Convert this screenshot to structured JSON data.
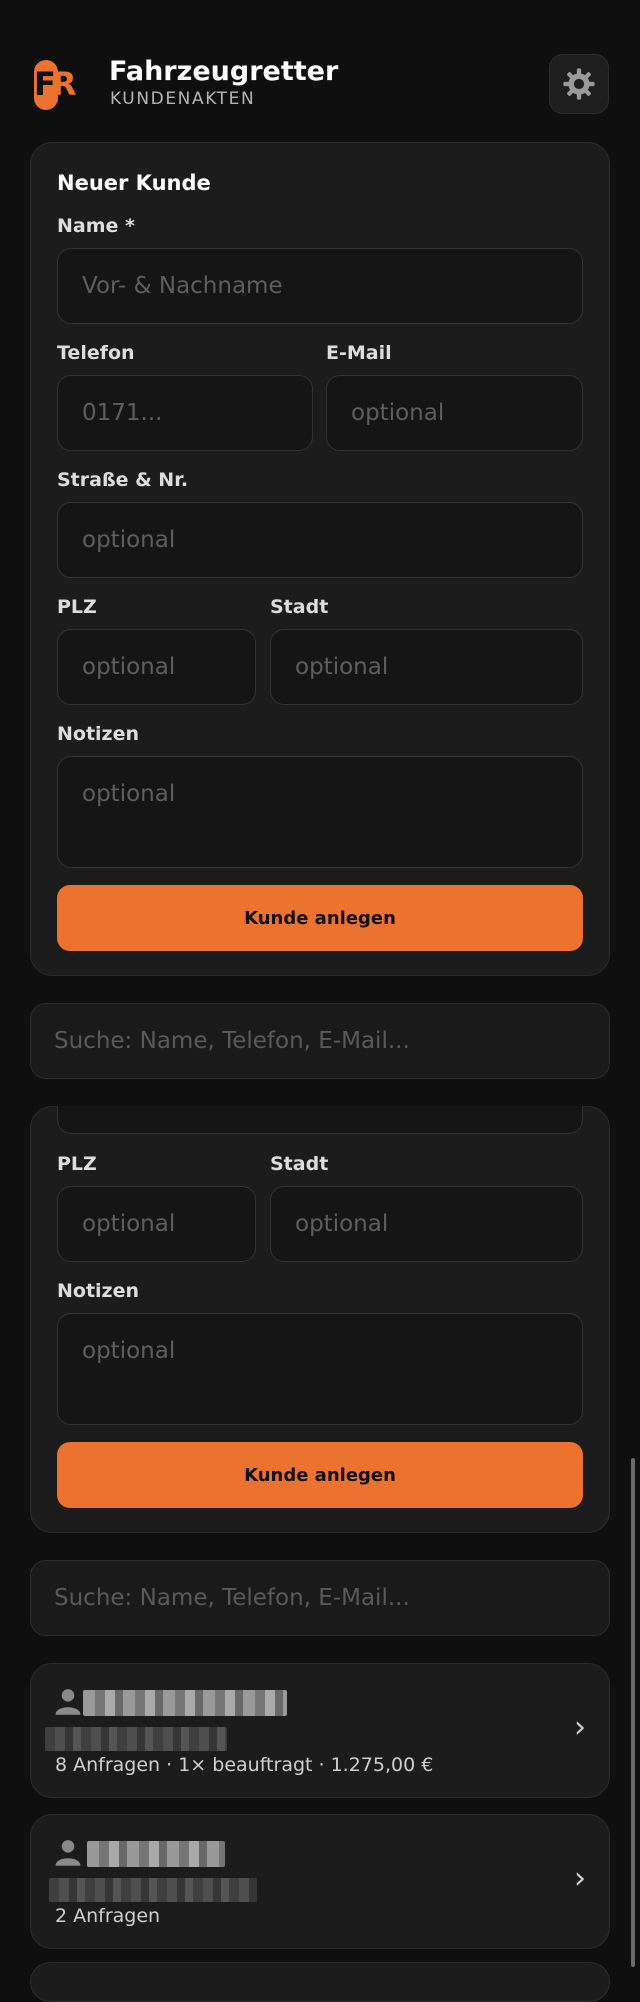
{
  "app": {
    "logo_text": "FR",
    "title": "Fahrzeugretter",
    "subtitle": "KUNDENAKTEN"
  },
  "form": {
    "title": "Neuer Kunde",
    "name_label": "Name *",
    "name_placeholder": "Vor- & Nachname",
    "phone_label": "Telefon",
    "phone_placeholder": "0171...",
    "email_label": "E-Mail",
    "email_placeholder": "optional",
    "street_label": "Straße & Nr.",
    "street_placeholder": "optional",
    "zip_label": "PLZ",
    "zip_placeholder": "optional",
    "city_label": "Stadt",
    "city_placeholder": "optional",
    "notes_label": "Notizen",
    "notes_placeholder": "optional",
    "submit_label": "Kunde anlegen"
  },
  "search": {
    "placeholder": "Suche: Name, Telefon, E-Mail..."
  },
  "customers": [
    {
      "meta": "8 Anfragen · 1× beauftragt · 1.275,00 €"
    },
    {
      "meta": "2 Anfragen"
    }
  ],
  "colors": {
    "accent": "#ec722f",
    "background": "#0f0f0f",
    "card": "#1c1c1c"
  },
  "icons": {
    "settings": "gear-icon",
    "customer": "person-icon",
    "open": "chevron-right-icon"
  }
}
